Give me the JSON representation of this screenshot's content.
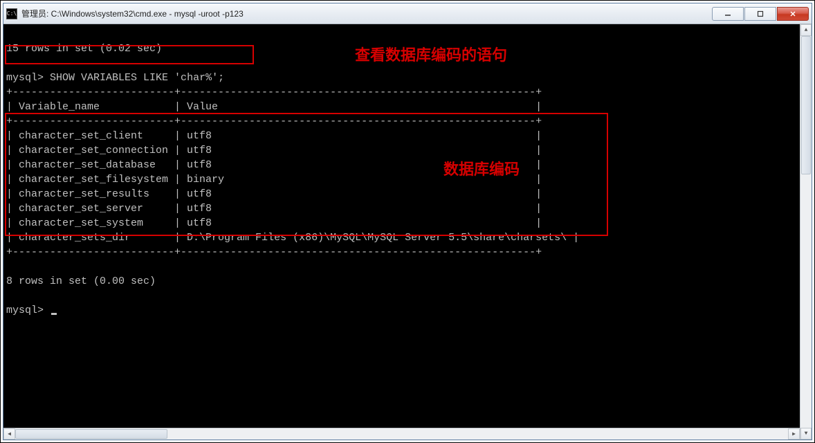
{
  "window": {
    "title": "管理员: C:\\Windows\\system32\\cmd.exe - mysql  -uroot -p123",
    "icon_label": "C:\\"
  },
  "terminal": {
    "prev_result": "15 rows in set (0.02 sec)",
    "prompt": "mysql>",
    "query": "SHOW VARIABLES LIKE 'char%';",
    "sep_top": "+--------------------------+---------------------------------------------------------+",
    "header_row": "| Variable_name            | Value                                                   |",
    "sep_mid": "+--------------------------+---------------------------------------------------------+",
    "data_rows": [
      "| character_set_client     | utf8                                                    |",
      "| character_set_connection | utf8                                                    |",
      "| character_set_database   | utf8                                                    |",
      "| character_set_filesystem | binary                                                  |",
      "| character_set_results    | utf8                                                    |",
      "| character_set_server     | utf8                                                    |",
      "| character_set_system     | utf8                                                    |",
      "| character_sets_dir       | D:\\Program Files (x86)\\MySQL\\MySQL Server 5.5\\share\\charsets\\ |"
    ],
    "sep_bot": "+--------------------------+---------------------------------------------------------+",
    "result_summary": "8 rows in set (0.00 sec)",
    "next_prompt": "mysql>"
  },
  "table_structured": {
    "columns": [
      "Variable_name",
      "Value"
    ],
    "rows": [
      {
        "Variable_name": "character_set_client",
        "Value": "utf8"
      },
      {
        "Variable_name": "character_set_connection",
        "Value": "utf8"
      },
      {
        "Variable_name": "character_set_database",
        "Value": "utf8"
      },
      {
        "Variable_name": "character_set_filesystem",
        "Value": "binary"
      },
      {
        "Variable_name": "character_set_results",
        "Value": "utf8"
      },
      {
        "Variable_name": "character_set_server",
        "Value": "utf8"
      },
      {
        "Variable_name": "character_set_system",
        "Value": "utf8"
      },
      {
        "Variable_name": "character_sets_dir",
        "Value": "D:\\Program Files (x86)\\MySQL\\MySQL Server 5.5\\share\\charsets\\"
      }
    ]
  },
  "annotations": {
    "label1": "查看数据库编码的语句",
    "label2": "数据库编码"
  },
  "controls": {
    "minimize": "—",
    "maximize": "☐",
    "close": "✕"
  }
}
